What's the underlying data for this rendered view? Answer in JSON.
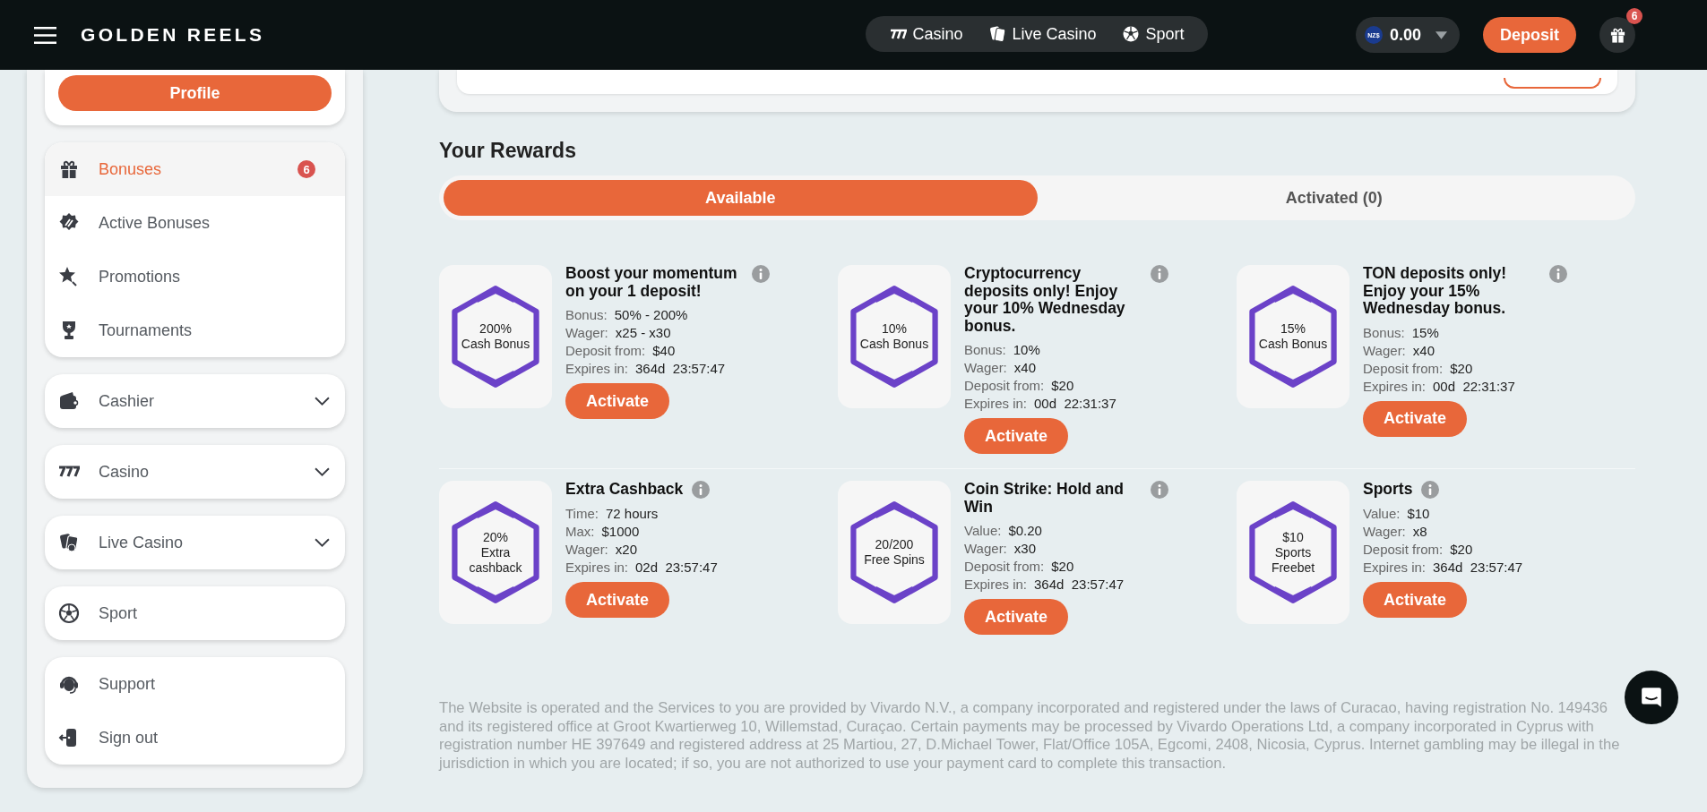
{
  "header": {
    "logo": "GOLDEN REELS",
    "nav": [
      {
        "label": "Casino"
      },
      {
        "label": "Live Casino"
      },
      {
        "label": "Sport"
      }
    ],
    "balance": {
      "currency": "NZ$",
      "amount": "0.00"
    },
    "deposit": "Deposit",
    "gift_badge": "6"
  },
  "sidebar": {
    "profile_button": "Profile",
    "groups": [
      [
        {
          "label": "Bonuses",
          "selected": true,
          "badge": "6"
        },
        {
          "label": "Active Bonuses",
          "selected": false
        },
        {
          "label": "Promotions",
          "selected": false
        },
        {
          "label": "Tournaments",
          "selected": false
        }
      ],
      [
        {
          "label": "Cashier",
          "selected": false,
          "expanded": false
        }
      ],
      [
        {
          "label": "Casino",
          "selected": false,
          "expanded": false
        }
      ],
      [
        {
          "label": "Live Casino",
          "selected": false,
          "expanded": false
        }
      ],
      [
        {
          "label": "Sport",
          "selected": false
        }
      ],
      [
        {
          "label": "Support",
          "selected": false
        },
        {
          "label": "Sign out",
          "selected": false
        }
      ]
    ]
  },
  "rewards": {
    "title": "Your Rewards",
    "tabs": [
      {
        "label": "Available",
        "selected": true
      },
      {
        "label": "Activated (0)",
        "selected": false
      }
    ],
    "rows": [
      [
        {
          "image": [
            "200%",
            "Cash Bonus"
          ],
          "title": "Boost your momentum on your 1 deposit!",
          "details": [
            {
              "label": "Bonus:",
              "value": "50% - 200%"
            },
            {
              "label": "Wager:",
              "value": "x25 - x30"
            },
            {
              "label": "Deposit from:",
              "value": "$40"
            },
            {
              "label": "Expires in:",
              "value": "364d  23:57:47"
            }
          ],
          "button": "Activate"
        },
        {
          "image": [
            "10%",
            "Cash Bonus"
          ],
          "title": "Cryptocurrency deposits only! Enjoy your 10% Wednesday bonus.",
          "details": [
            {
              "label": "Bonus:",
              "value": "10%"
            },
            {
              "label": "Wager:",
              "value": "x40"
            },
            {
              "label": "Deposit from:",
              "value": "$20"
            },
            {
              "label": "Expires in:",
              "value": "00d  22:31:37"
            }
          ],
          "button": "Activate"
        },
        {
          "image": [
            "15%",
            "Cash Bonus"
          ],
          "title": "TON deposits only! Enjoy your 15% Wednesday bonus.",
          "details": [
            {
              "label": "Bonus:",
              "value": "15%"
            },
            {
              "label": "Wager:",
              "value": "x40"
            },
            {
              "label": "Deposit from:",
              "value": "$20"
            },
            {
              "label": "Expires in:",
              "value": "00d  22:31:37"
            }
          ],
          "button": "Activate"
        }
      ],
      [
        {
          "image": [
            "20%",
            "Extra",
            "cashback"
          ],
          "title": "Extra Cashback",
          "details": [
            {
              "label": "Time:",
              "value": "72 hours"
            },
            {
              "label": "Max:",
              "value": "$1000"
            },
            {
              "label": "Wager:",
              "value": "x20"
            },
            {
              "label": "Expires in:",
              "value": "02d  23:57:47"
            }
          ],
          "button": "Activate"
        },
        {
          "image": [
            "20/200",
            "Free Spins"
          ],
          "title": "Coin Strike: Hold and Win",
          "details": [
            {
              "label": "Value:",
              "value": "$0.20"
            },
            {
              "label": "Wager:",
              "value": "x30"
            },
            {
              "label": "Deposit from:",
              "value": "$20"
            },
            {
              "label": "Expires in:",
              "value": "364d  23:57:47"
            }
          ],
          "button": "Activate"
        },
        {
          "image": [
            "$10",
            "Sports",
            "Freebet"
          ],
          "title": "Sports",
          "details": [
            {
              "label": "Value:",
              "value": "$10"
            },
            {
              "label": "Wager:",
              "value": "x8"
            },
            {
              "label": "Deposit from:",
              "value": "$20"
            },
            {
              "label": "Expires in:",
              "value": "364d  23:57:47"
            }
          ],
          "button": "Activate"
        }
      ]
    ]
  },
  "footer": "The Website is operated and the Services to you are provided by Vivardo N.V., a company incorporated and registered under the laws of Curacao, having registration No. 149436 and its registered office at Groot Kwartierweg 10, Willemstad, Curaçao. Certain payments may be processed by Vivardo Operations Ltd, a company incorporated in Cyprus with registration number HE 397649 and registered address at 25 Martiou, 27, D.Michael Tower, Flat/Office 105A, Egcomi, 2408, Nicosia, Cyprus. Internet gambling may be illegal in the jurisdiction in which you are located; if so, you are not authorized to use your payment card to complete this transaction."
}
